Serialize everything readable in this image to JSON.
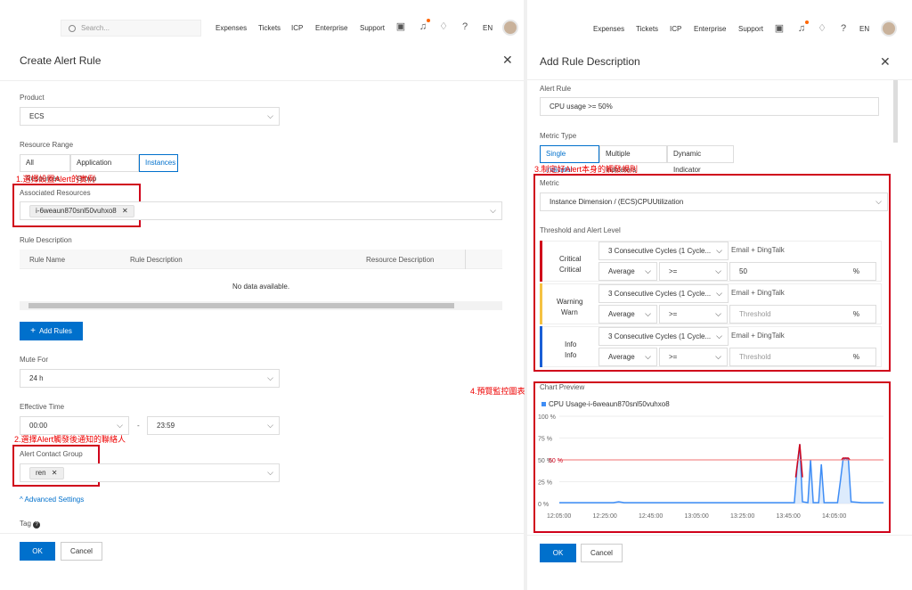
{
  "topbar": {
    "search_placeholder": "Search...",
    "nav": [
      "Expenses",
      "Tickets",
      "ICP",
      "Enterprise",
      "Support"
    ],
    "lang": "EN"
  },
  "left": {
    "title": "Create Alert Rule",
    "product_label": "Product",
    "product_value": "ECS",
    "resource_range_label": "Resource Range",
    "resource_range_options": [
      "All Resources",
      "Application Group",
      "Instances"
    ],
    "annotation1": "1.選擇設置Alert的實例",
    "associated_resources_label": "Associated Resources",
    "associated_resource_tag": "i-6weaun870snl50vuhxo8",
    "rule_description_label": "Rule Description",
    "table_headers": [
      "Rule Name",
      "Rule Description",
      "Resource Description"
    ],
    "table_empty": "No data available.",
    "add_rules": "Add Rules",
    "mute_for_label": "Mute For",
    "mute_for_value": "24 h",
    "effective_time_label": "Effective Time",
    "effective_start": "00:00",
    "effective_sep": "-",
    "effective_end": "23:59",
    "annotation2": "2.選擇Alert觸發後通知的聯絡人",
    "contact_group_label": "Alert Contact Group",
    "contact_group_tag": "ren",
    "advanced_settings": "Advanced Settings",
    "tag_label": "Tag",
    "ok": "OK",
    "cancel": "Cancel"
  },
  "right": {
    "title": "Add Rule Description",
    "alert_rule_label": "Alert Rule",
    "alert_rule_value": "CPU usage >= 50%",
    "metric_type_label": "Metric Type",
    "metric_type_options": [
      "Single indicator",
      "Multiple indicators",
      "Dynamic Indicator"
    ],
    "annotation3": "3.制定好Alert本身的觸發規則",
    "metric_label": "Metric",
    "metric_value": "Instance Dimension / (ECS)CPUUtilization",
    "threshold_label": "Threshold and Alert Level",
    "levels": [
      {
        "name1": "Critical",
        "name2": "Critical",
        "cycles": "3 Consecutive Cycles (1 Cycle...",
        "notify": "Email + DingTalk",
        "agg": "Average",
        "op": ">=",
        "threshold": "50",
        "threshold_placeholder": "",
        "unit": "%",
        "color": "#d0021b"
      },
      {
        "name1": "Warning",
        "name2": "Warn",
        "cycles": "3 Consecutive Cycles (1 Cycle...",
        "notify": "Email + DingTalk",
        "agg": "Average",
        "op": ">=",
        "threshold": "",
        "threshold_placeholder": "Threshold",
        "unit": "%",
        "color": "#f5c242"
      },
      {
        "name1": "Info",
        "name2": "Info",
        "cycles": "3 Consecutive Cycles (1 Cycle...",
        "notify": "Email + DingTalk",
        "agg": "Average",
        "op": ">=",
        "threshold": "",
        "threshold_placeholder": "Threshold",
        "unit": "%",
        "color": "#1a5fd6"
      }
    ],
    "annotation4": "4.預覽監控圖表",
    "chart_preview_label": "Chart Preview",
    "ok": "OK",
    "cancel": "Cancel"
  },
  "chart_data": {
    "type": "line",
    "series": [
      {
        "name": "CPU Usage-i-6weaun870snl50vuhxo8",
        "color": "#3f8df5"
      }
    ],
    "y_ticks": [
      "100 %",
      "75 %",
      "50 %",
      "25 %",
      "0 %"
    ],
    "x_ticks": [
      "12:05:00",
      "12:25:00",
      "12:45:00",
      "13:05:00",
      "13:25:00",
      "13:45:00",
      "14:05:00"
    ],
    "threshold_label": "50 %",
    "threshold": 50,
    "ylim": [
      0,
      100
    ],
    "points": [
      [
        0,
        1
      ],
      [
        10,
        1
      ],
      [
        20,
        1
      ],
      [
        22,
        2
      ],
      [
        24,
        1
      ],
      [
        40,
        1
      ],
      [
        60,
        1
      ],
      [
        70,
        1
      ],
      [
        80,
        1
      ],
      [
        87,
        1
      ],
      [
        88,
        40
      ],
      [
        89,
        68
      ],
      [
        90,
        2
      ],
      [
        92,
        1
      ],
      [
        93,
        50
      ],
      [
        94,
        1
      ],
      [
        96,
        1
      ],
      [
        97,
        45
      ],
      [
        98,
        1
      ],
      [
        103,
        1
      ],
      [
        104,
        25
      ],
      [
        105,
        50
      ],
      [
        106,
        52
      ],
      [
        107,
        50
      ],
      [
        108,
        2
      ],
      [
        112,
        1
      ],
      [
        120,
        1
      ]
    ],
    "x_range": [
      0,
      120
    ]
  }
}
